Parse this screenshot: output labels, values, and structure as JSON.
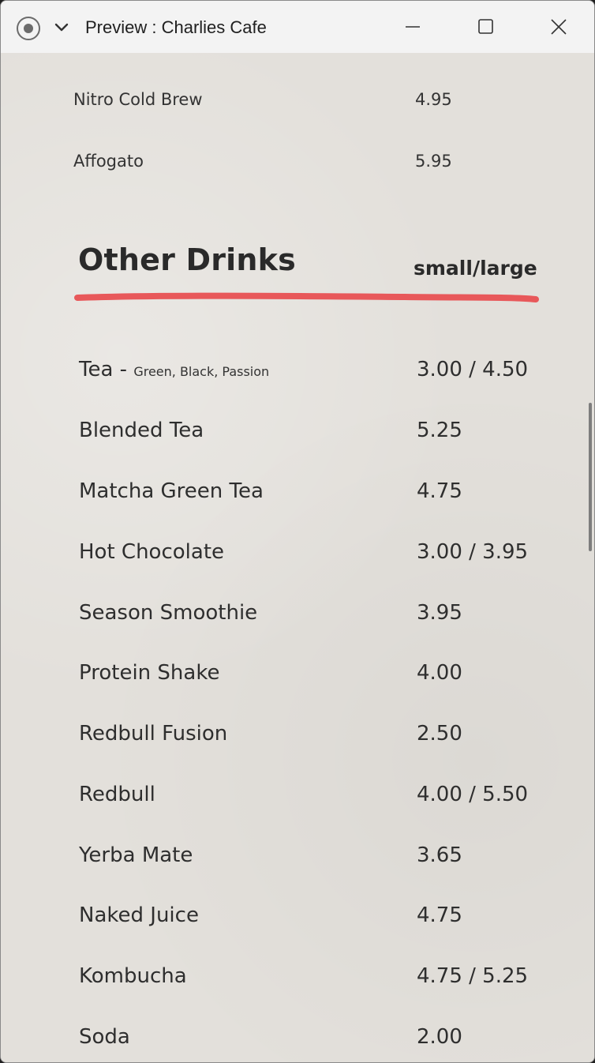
{
  "window": {
    "title": "Preview : Charlies Cafe"
  },
  "icons": {
    "record": "record-icon",
    "chevron": "chevron-down-icon",
    "minimize": "minimize-icon",
    "maximize": "maximize-icon",
    "close": "close-icon"
  },
  "colors": {
    "paper": "#e3e0db",
    "accent_underline": "#e8585a",
    "text": "#2e2e2e"
  },
  "previous_items": [
    {
      "name": "Nitro Cold Brew",
      "price": "4.95"
    },
    {
      "name": "Affogato",
      "price": "5.95"
    }
  ],
  "section": {
    "title": "Other Drinks",
    "size_label": "small/large"
  },
  "items": [
    {
      "name": "Tea - ",
      "note": "Green, Black, Passion",
      "price": "3.00 / 4.50"
    },
    {
      "name": "Blended Tea",
      "price": "5.25"
    },
    {
      "name": "Matcha Green Tea",
      "price": "4.75"
    },
    {
      "name": "Hot Chocolate",
      "price": "3.00 / 3.95"
    },
    {
      "name": "Season Smoothie",
      "price": "3.95"
    },
    {
      "name": "Protein Shake",
      "price": "4.00"
    },
    {
      "name": "Redbull Fusion",
      "price": "2.50"
    },
    {
      "name": "Redbull",
      "price": "4.00 / 5.50"
    },
    {
      "name": "Yerba Mate",
      "price": "3.65"
    },
    {
      "name": "Naked Juice",
      "price": "4.75"
    },
    {
      "name": "Kombucha",
      "price": "4.75 / 5.25"
    },
    {
      "name": "Soda",
      "price": "2.00"
    }
  ]
}
